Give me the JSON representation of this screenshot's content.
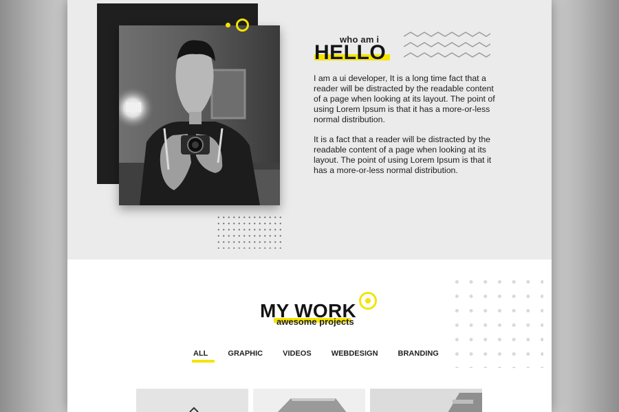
{
  "about": {
    "subtitle": "who am i",
    "title": "HELLO",
    "paragraphs": [
      "I am a ui developer, It is a long time fact that a reader will be distracted by the readable content of a page when looking at its layout. The point of using Lorem Ipsum is that it has a more-or-less normal distribution.",
      "It is a fact that a reader will be distracted by the readable content of a page when looking at its layout. The point of using Lorem Ipsum is that it has a more-or-less normal distribution."
    ]
  },
  "work": {
    "title": "MY WORK",
    "subtitle": "awesome projects",
    "tabs": [
      "ALL",
      "GRAPHIC",
      "VIDEOS",
      "WEBDESIGN",
      "BRANDING"
    ],
    "active_tab": "ALL"
  },
  "colors": {
    "accent": "#f4e400",
    "dark": "#1f1f1f",
    "about_bg": "#ebebeb",
    "text": "#141414"
  },
  "icons": [
    "zigzag-pattern-icon",
    "ring-decoration-icon",
    "dot-grid-pattern"
  ]
}
